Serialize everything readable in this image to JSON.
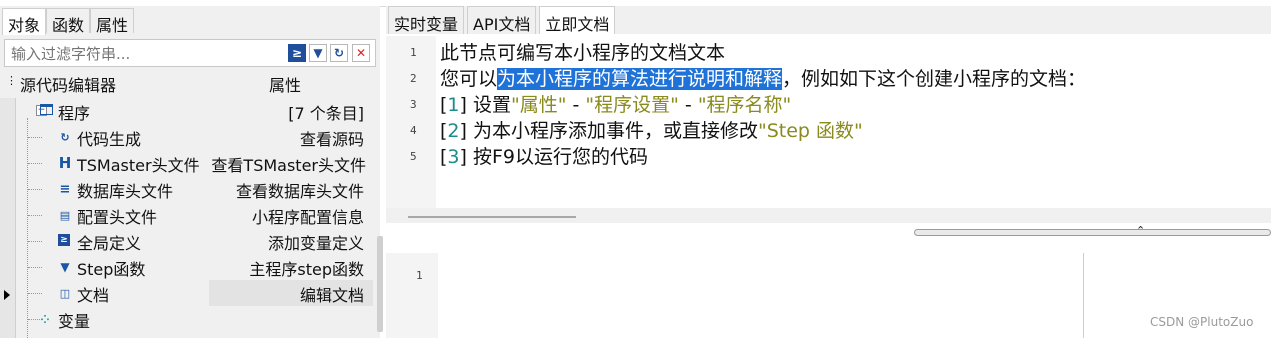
{
  "left_panel": {
    "tabs": [
      "对象",
      "函数",
      "属性"
    ],
    "filter_placeholder": "输入过滤字符串...",
    "columns": {
      "name": "源代码编辑器",
      "prop": "属性"
    },
    "root": {
      "label": "程序",
      "value": "[7 个条目]"
    },
    "items": [
      {
        "icon": "code-gen-icon",
        "label": "代码生成",
        "value": "查看源码"
      },
      {
        "icon": "header-h-icon",
        "label": "TSMaster头文件",
        "value": "查看TSMaster头文件"
      },
      {
        "icon": "database-icon",
        "label": "数据库头文件",
        "value": "查看数据库头文件"
      },
      {
        "icon": "config-file-icon",
        "label": "配置头文件",
        "value": "小程序配置信息"
      },
      {
        "icon": "global-def-icon",
        "label": "全局定义",
        "value": "添加变量定义"
      },
      {
        "icon": "step-triangle-icon",
        "label": "Step函数",
        "value": "主程序step函数"
      },
      {
        "icon": "book-icon",
        "label": "文档",
        "value": "编辑文档"
      }
    ],
    "variables": "变量"
  },
  "right_panel": {
    "tabs": [
      "实时变量",
      "API文档",
      "立即文档"
    ],
    "line_numbers": [
      "1",
      "2",
      "3",
      "4",
      "5"
    ],
    "lines": {
      "l1": "此节点可编写本小程序的文档文本",
      "l2_a": "您可以",
      "l2_hl": "为本小程序的算法进行说明和解释",
      "l2_b": "，例如如下这个创建小程序的文档：",
      "l3_open": "[",
      "l3_num": "1",
      "l3_close": "] 设置",
      "l3_s1": "\"属性\"",
      "l3_d1": " - ",
      "l3_s2": "\"程序设置\"",
      "l3_d2": " - ",
      "l3_s3": "\"程序名称\"",
      "l4_open": "[",
      "l4_num": "2",
      "l4_close": "] 为本小程序添加事件，或直接修改",
      "l4_s": "\"Step 函数\"",
      "l5_open": "[",
      "l5_num": "3",
      "l5_close": "] 按F9以运行您的代码"
    },
    "editor2_line": "1"
  },
  "watermark": "CSDN @PlutoZuo",
  "colors": {
    "highlight": "#1e72d8",
    "number": "#1e8a8a",
    "string": "#8a8a1e"
  }
}
